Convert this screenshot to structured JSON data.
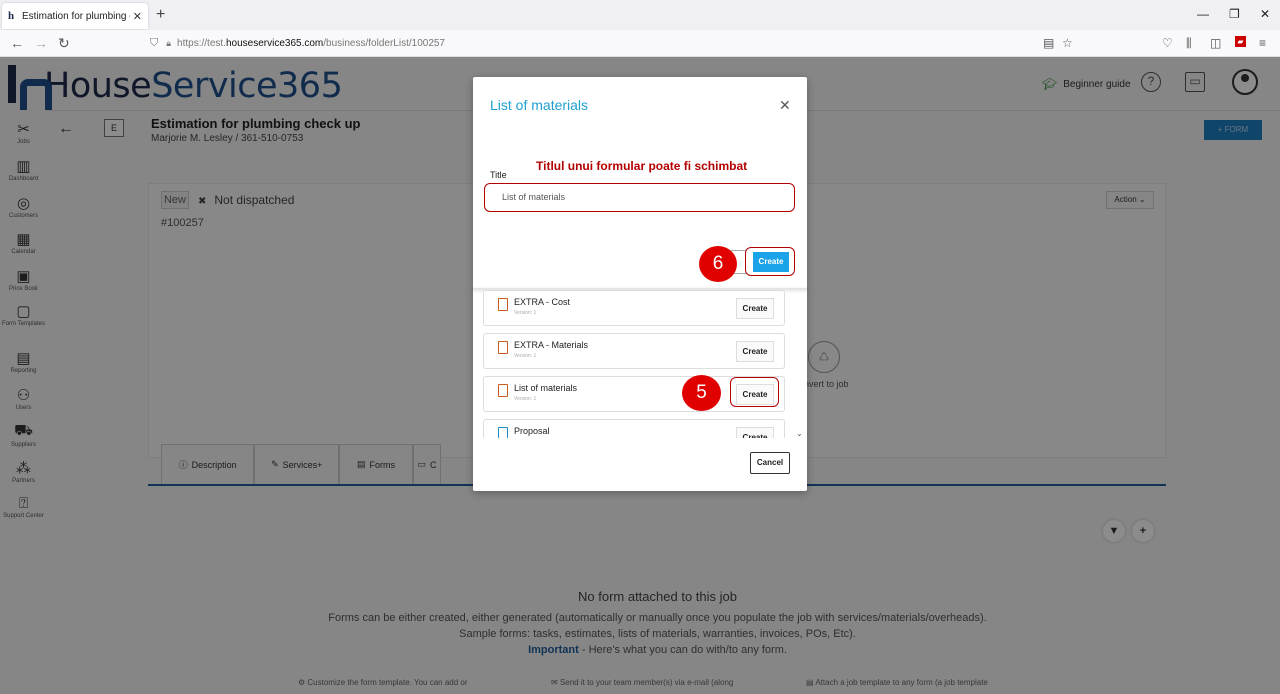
{
  "browser": {
    "tab_title": "Estimation for plumbing check up",
    "url_prefix": "https://test.",
    "url_domain": "houseservice365.com",
    "url_path": "/business/folderList/100257"
  },
  "app": {
    "logo_part1": "House",
    "logo_part2": "Service365",
    "beginner_guide": "Beginner guide",
    "sidebar": [
      {
        "label": "Jobs",
        "icon": "tools-icon"
      },
      {
        "label": "Dashboard",
        "icon": "chart-icon"
      },
      {
        "label": "Customers",
        "icon": "target-icon"
      },
      {
        "label": "Calendar",
        "icon": "calendar-icon"
      },
      {
        "label": "Price Book",
        "icon": "pricebook-icon"
      },
      {
        "label": "Form Templates",
        "icon": "template-icon"
      },
      {
        "label": "Reporting",
        "icon": "report-icon"
      },
      {
        "label": "Users",
        "icon": "users-icon"
      },
      {
        "label": "Suppliers",
        "icon": "truck-icon"
      },
      {
        "label": "Partners",
        "icon": "partners-icon"
      },
      {
        "label": "Support Center",
        "icon": "help-icon"
      }
    ],
    "job": {
      "badge": "E",
      "title": "Estimation for plumbing check up",
      "subtitle": "Marjorie M. Lesley / 361-510-0753",
      "form_button": "+ FORM",
      "status_new": "New",
      "status_dispatch": "Not dispatched",
      "number": "#100257",
      "action": "Action",
      "convert": "nvert to job"
    },
    "tabs": [
      {
        "label": "Description",
        "icon": "info-icon"
      },
      {
        "label": "Services+",
        "icon": "wrench-icon"
      },
      {
        "label": "Forms",
        "icon": "form-icon"
      },
      {
        "label": "C",
        "icon": "card-icon"
      }
    ],
    "forms_empty": {
      "title": "No form attached to this job",
      "line1": "Forms can be either created, either generated (automatically or manually once you populate the job with services/materials/overheads).",
      "line2": "Sample forms: tasks, estimates, lists of materials, warranties, invoices, POs, Etc).",
      "important": "Important",
      "line3": " - Here's what you can do with/to any form.",
      "foot1": "Customize the form template. You can add or",
      "foot2": "Send it to your team member(s) via e-mail (along",
      "foot3": "Attach a job template to any form (a job template"
    }
  },
  "modal": {
    "title": "List of materials",
    "annotation": "Titlul unui formular poate fi schimbat",
    "title_label": "Title",
    "title_value": "List of materials",
    "create_label": "Create",
    "step6": "6",
    "step5": "5",
    "templates": [
      {
        "name": "EXTRA - Cost",
        "version": "Version: 1",
        "action": "Create"
      },
      {
        "name": "EXTRA - Materials",
        "version": "Version: 1",
        "action": "Create"
      },
      {
        "name": "List of materials",
        "version": "Version: 1",
        "action": "Create"
      },
      {
        "name": "Proposal",
        "version": "",
        "action": "Create"
      }
    ],
    "cancel": "Cancel"
  }
}
